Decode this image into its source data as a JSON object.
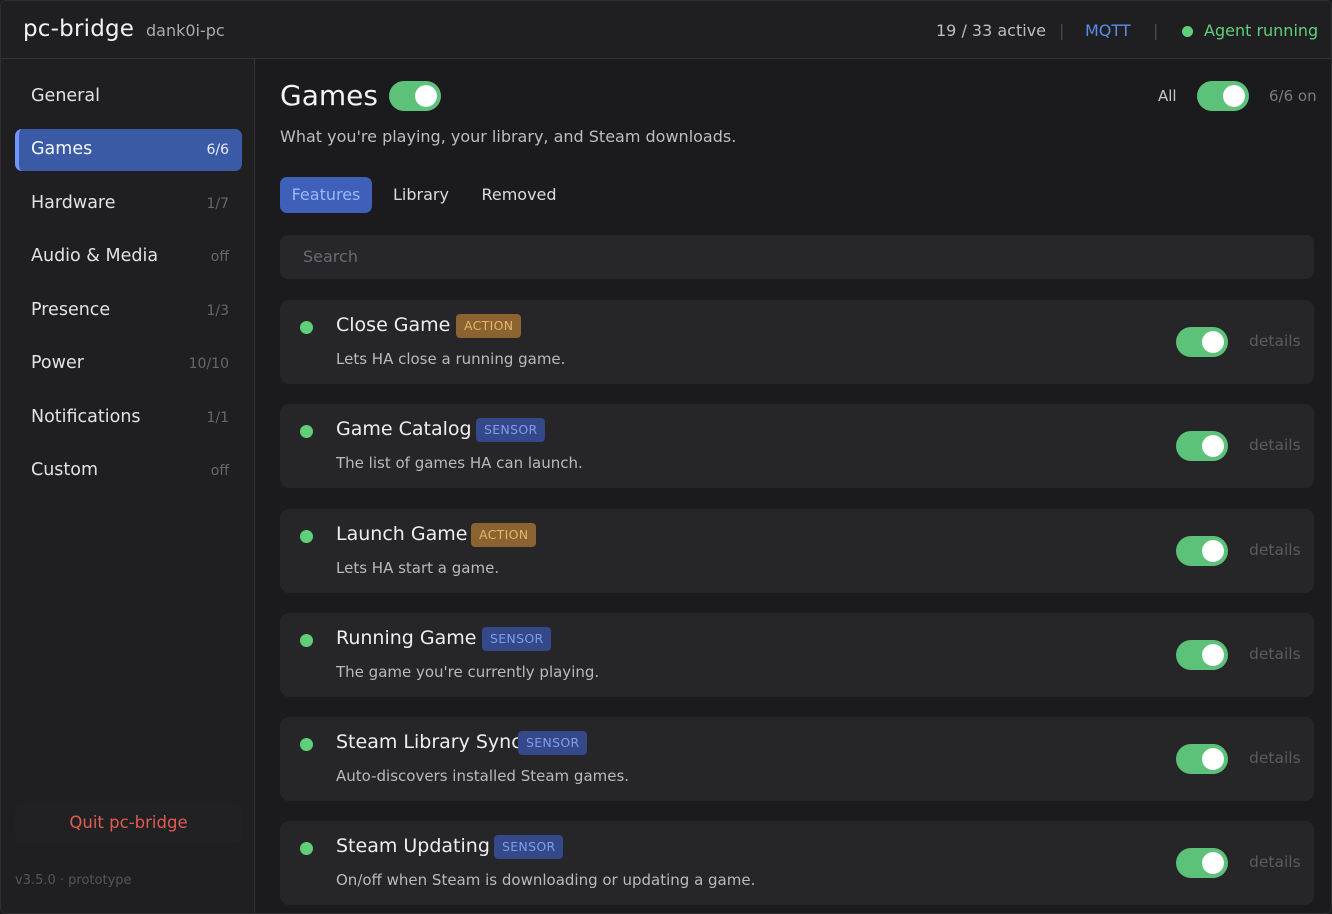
{
  "header": {
    "app_title": "pc-bridge",
    "host": "dank0i-pc",
    "active_count": "19 / 33 active",
    "separator": "|",
    "mqtt_label": "MQTT",
    "agent_status": "Agent running"
  },
  "sidebar": {
    "items": [
      {
        "label": "General",
        "count": ""
      },
      {
        "label": "Games",
        "count": "6/6",
        "active": true
      },
      {
        "label": "Hardware",
        "count": "1/7"
      },
      {
        "label": "Audio & Media",
        "count": "off"
      },
      {
        "label": "Presence",
        "count": "1/3"
      },
      {
        "label": "Power",
        "count": "10/10"
      },
      {
        "label": "Notifications",
        "count": "1/1"
      },
      {
        "label": "Custom",
        "count": "off"
      }
    ],
    "quit_label": "Quit pc-bridge",
    "version": "v3.5.0 · prototype"
  },
  "main": {
    "title": "Games",
    "title_toggle_on": true,
    "subtitle": "What you're playing, your library, and Steam downloads.",
    "all_label": "All",
    "all_toggle_on": true,
    "all_count": "6/6 on",
    "tabs": [
      {
        "label": "Features",
        "active": true
      },
      {
        "label": "Library"
      },
      {
        "label": "Removed"
      }
    ],
    "search_placeholder": "Search",
    "features": [
      {
        "name": "Close Game",
        "badge": "ACTION",
        "description": "Lets HA close a running game.",
        "enabled": true,
        "details_label": "details"
      },
      {
        "name": "Game Catalog",
        "badge": "SENSOR",
        "description": "The list of games HA can launch.",
        "enabled": true,
        "details_label": "details"
      },
      {
        "name": "Launch Game",
        "badge": "ACTION",
        "description": "Lets HA start a game.",
        "enabled": true,
        "details_label": "details"
      },
      {
        "name": "Running Game",
        "badge": "SENSOR",
        "description": "The game you're currently playing.",
        "enabled": true,
        "details_label": "details"
      },
      {
        "name": "Steam Library Sync",
        "badge": "SENSOR",
        "description": "Auto-discovers installed Steam games.",
        "enabled": true,
        "details_label": "details"
      },
      {
        "name": "Steam Updating",
        "badge": "SENSOR",
        "description": "On/off when Steam is downloading or updating a game.",
        "enabled": true,
        "details_label": "details"
      }
    ]
  },
  "colors": {
    "accent_blue": "#3b5aa6",
    "toggle_green": "#5cc27a",
    "status_green": "#5fcf7a",
    "action_badge": "#8a6330",
    "sensor_badge": "#34488a",
    "quit_red": "#e05b52"
  }
}
